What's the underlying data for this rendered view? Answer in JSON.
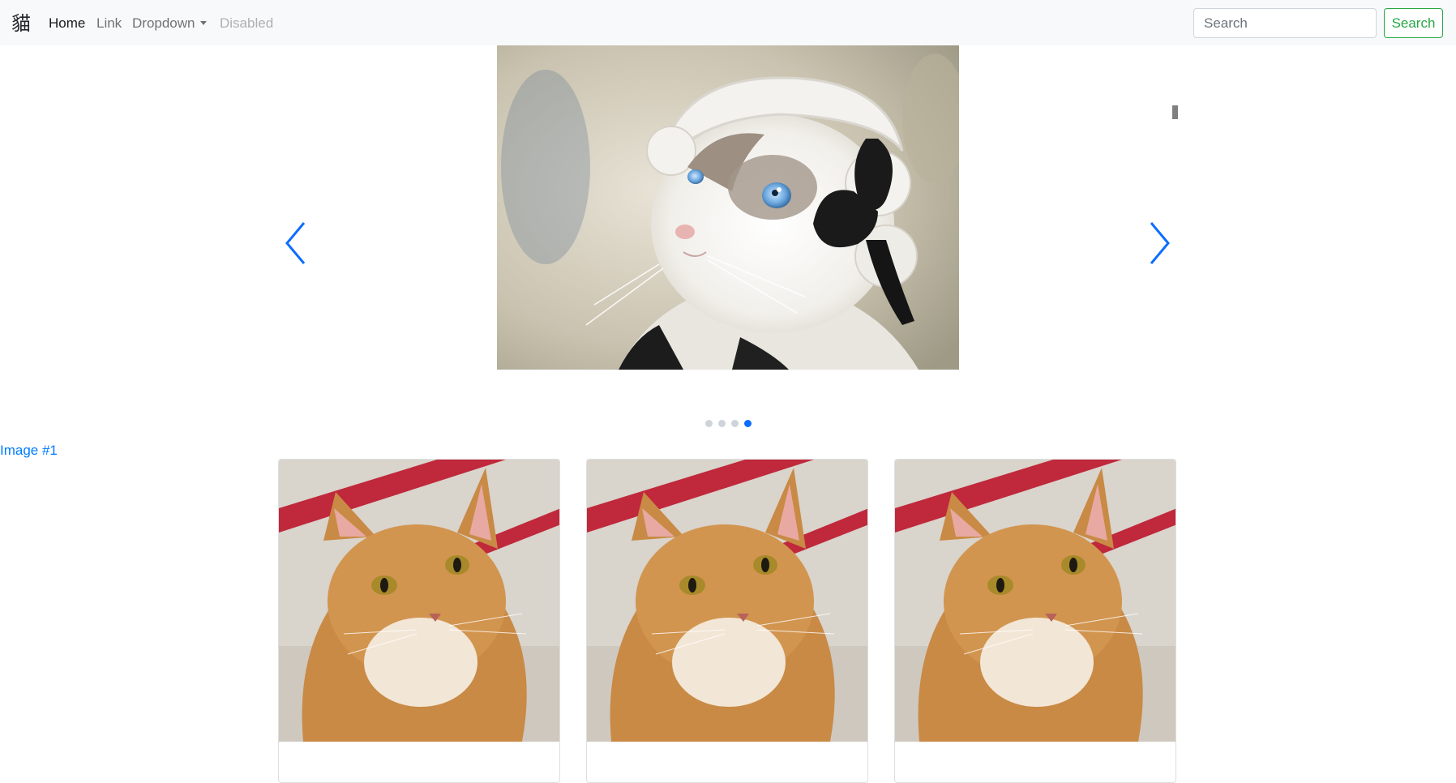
{
  "navbar": {
    "brand": "貓",
    "links": [
      {
        "label": "Home",
        "state": "active"
      },
      {
        "label": "Link",
        "state": "normal"
      },
      {
        "label": "Dropdown",
        "state": "normal"
      },
      {
        "label": "Disabled",
        "state": "disabled"
      }
    ],
    "search": {
      "placeholder": "Search",
      "value": ""
    },
    "search_button_label": "Search"
  },
  "carousel": {
    "slide_count": 4,
    "active_slide": 4,
    "image_subject": "white ragdoll kitten wearing a frilly maid bonnet with black ribbon",
    "prev_icon": "chevron-left-icon",
    "next_icon": "chevron-right-icon"
  },
  "image_link": "Image #1",
  "cards": [
    {
      "image_subject": "orange tabby cat"
    },
    {
      "image_subject": "orange tabby cat"
    },
    {
      "image_subject": "orange tabby cat"
    }
  ],
  "colors": {
    "navbar_bg": "#f8f9fa",
    "accent_blue": "#007bff",
    "success_green": "#28a745",
    "indicator_active": "#0d6efd",
    "indicator_inactive": "#ced4da"
  }
}
